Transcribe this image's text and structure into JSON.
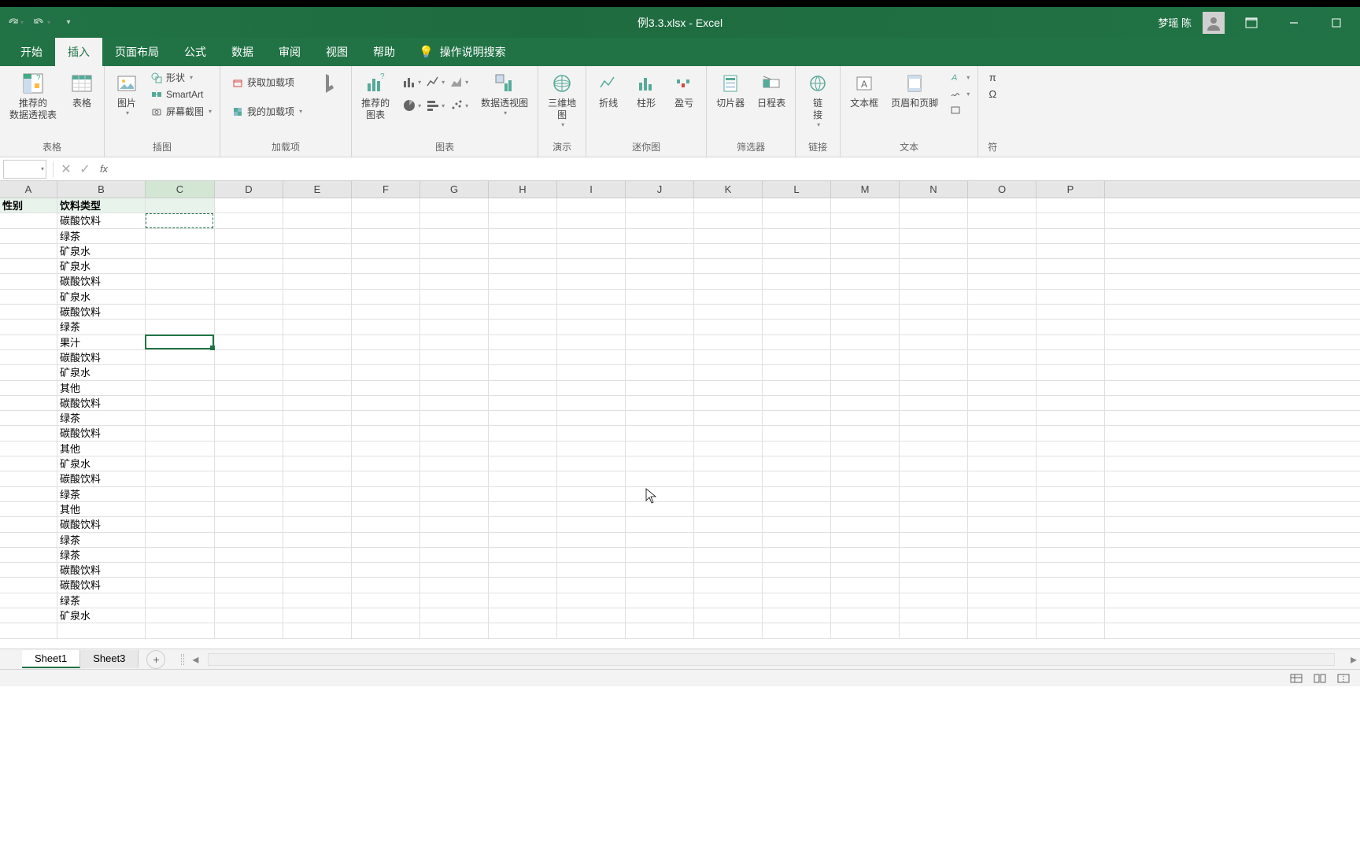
{
  "title": "例3.3.xlsx - Excel",
  "user": "梦瑶 陈",
  "tabs": [
    "开始",
    "插入",
    "页面布局",
    "公式",
    "数据",
    "审阅",
    "视图",
    "帮助"
  ],
  "active_tab": 1,
  "tellme": "操作说明搜索",
  "ribbon": {
    "g1": {
      "label": "表格",
      "pivot_rec": "推荐的\n数据透视表",
      "table": "表格"
    },
    "g2": {
      "label": "插图",
      "picture": "图片",
      "shapes": "形状",
      "smartart": "SmartArt",
      "screenshot": "屏幕截图"
    },
    "g3": {
      "label": "加载项",
      "get": "获取加载项",
      "my": "我的加载项"
    },
    "g4": {
      "label": "图表",
      "rec": "推荐的\n图表",
      "pivot_chart": "数据透视图"
    },
    "g5": {
      "label": "演示",
      "map3d": "三维地\n图"
    },
    "g6": {
      "label": "迷你图",
      "line": "折线",
      "column": "柱形",
      "winloss": "盈亏"
    },
    "g7": {
      "label": "筛选器",
      "slicer": "切片器",
      "timeline": "日程表"
    },
    "g8": {
      "label": "链接",
      "link": "链\n接"
    },
    "g9": {
      "label": "文本",
      "textbox": "文本框",
      "headerfooter": "页眉和页脚"
    },
    "g10": {
      "label": "符"
    }
  },
  "columns": [
    "A",
    "B",
    "C",
    "D",
    "E",
    "F",
    "G",
    "H",
    "I",
    "J",
    "K",
    "L",
    "M",
    "N",
    "O",
    "P"
  ],
  "col_start_header_highlight": "C",
  "data": {
    "A1": "性别",
    "B1": "饮料类型",
    "B": [
      "碳酸饮料",
      "绿茶",
      "矿泉水",
      "矿泉水",
      "碳酸饮料",
      "矿泉水",
      "碳酸饮料",
      "绿茶",
      "果汁",
      "碳酸饮料",
      "矿泉水",
      "其他",
      "碳酸饮料",
      "绿茶",
      "碳酸饮料",
      "其他",
      "矿泉水",
      "碳酸饮料",
      "绿茶",
      "其他",
      "碳酸饮料",
      "绿茶",
      "绿茶",
      "碳酸饮料",
      "碳酸饮料",
      "绿茶",
      "矿泉水"
    ]
  },
  "sheets": [
    "Sheet1",
    "Sheet3"
  ],
  "active_sheet": 0
}
